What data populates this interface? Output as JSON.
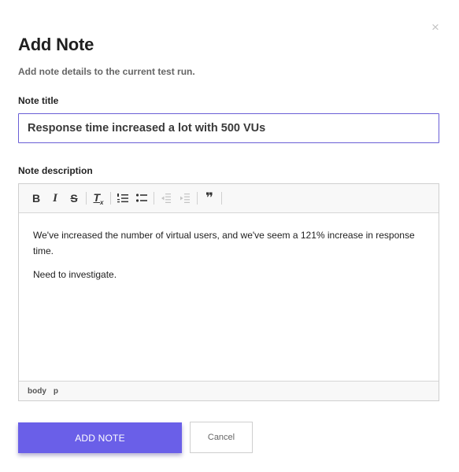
{
  "modal": {
    "title": "Add Note",
    "subtitle": "Add note details to the current test run.",
    "close_label": "×"
  },
  "form": {
    "title_label": "Note title",
    "title_value": "Response time increased a lot with 500 VUs",
    "description_label": "Note description",
    "description_paragraphs": [
      "We've increased the number of virtual users, and we've seem a 121% increase in response time.",
      "Need to investigate."
    ]
  },
  "toolbar": {
    "bold_label": "B",
    "italic_label": "I",
    "strike_label": "S",
    "clear_format_label": "T",
    "clear_format_sub": "x",
    "icons": [
      "bold-icon",
      "italic-icon",
      "strikethrough-icon",
      "clear-format-icon",
      "numbered-list-icon",
      "bulleted-list-icon",
      "outdent-icon",
      "indent-icon",
      "blockquote-icon"
    ],
    "quote_label": "❞"
  },
  "statusbar": {
    "path": [
      "body",
      "p"
    ]
  },
  "actions": {
    "primary_label": "ADD NOTE",
    "secondary_label": "Cancel"
  },
  "colors": {
    "accent": "#6a5fe8",
    "input_border": "#6a5fd6"
  }
}
